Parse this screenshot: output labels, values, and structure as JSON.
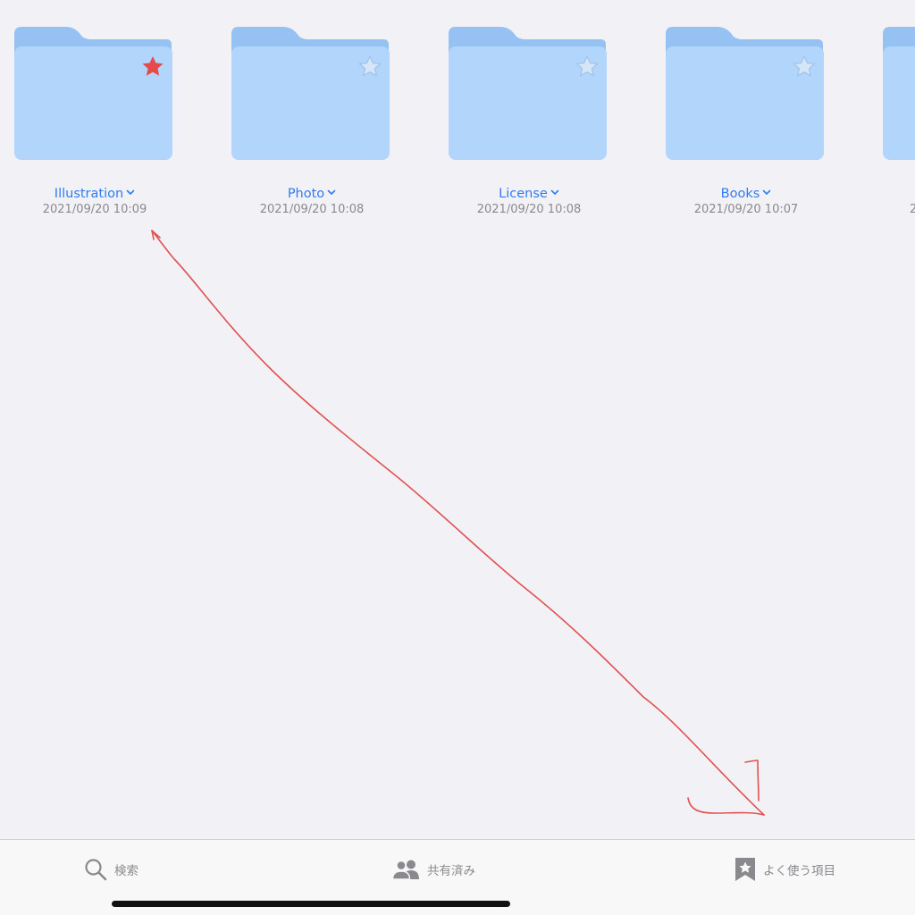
{
  "folders": [
    {
      "name": "Illustration",
      "date": "2021/09/20 10:09",
      "favorite": true
    },
    {
      "name": "Photo",
      "date": "2021/09/20 10:08",
      "favorite": false
    },
    {
      "name": "License",
      "date": "2021/09/20 10:08",
      "favorite": false
    },
    {
      "name": "Books",
      "date": "2021/09/20 10:07",
      "favorite": false
    },
    {
      "name": "",
      "date": "2",
      "favorite": false
    }
  ],
  "tabs": {
    "search": {
      "label": "検索",
      "icon": "magnifier-icon"
    },
    "shared": {
      "label": "共有済み",
      "icon": "people-icon"
    },
    "favorites": {
      "label": "よく使う項目",
      "icon": "bookmark-star-icon"
    }
  },
  "colors": {
    "background": "#f2f1f6",
    "folder_body": "#b1d5fb",
    "folder_tab": "#95c1f3",
    "link_blue": "#2f7cf0",
    "date_gray": "#8a8a8e",
    "star_favorite": "#e64a4a",
    "annotation_red": "#e05252"
  }
}
